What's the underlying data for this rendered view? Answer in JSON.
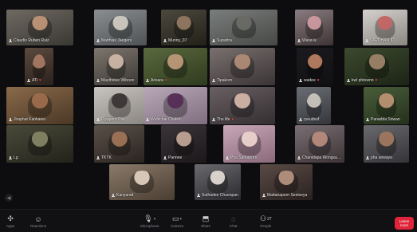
{
  "meeting": {
    "participants": [
      {
        "name": "Claudio Ruben Ruiz",
        "icon": "mic-icon",
        "colors": [
          "#6f6a62",
          "#3a3833"
        ],
        "fig": "#c89a7a"
      },
      {
        "name": "Matthias Jaegers",
        "icon": "mic-icon",
        "colors": [
          "#8b8f92",
          "#4f5254"
        ],
        "fig": "#d8d2c8"
      },
      {
        "name": "Munny_07",
        "icon": "mic-icon",
        "colors": [
          "#4c4a3e",
          "#222018"
        ],
        "fig": "#9a7e66"
      },
      {
        "name": "Supattra",
        "icon": "mic-icon",
        "colors": [
          "#7a7e7c",
          "#464845"
        ],
        "fig": "#6a6a64"
      },
      {
        "name": "Wasa w",
        "icon": "mic-icon",
        "colors": [
          "#8a7c80",
          "#3e3434"
        ],
        "fig": "#d6a0a6"
      },
      {
        "name": "VARDHAN ID",
        "icon": "mic-icon",
        "colors": [
          "#d4d0cc",
          "#8a8680"
        ],
        "fig": "#c45a5a"
      },
      {
        "name": "ATi",
        "icon": "mic-icon",
        "heart": true,
        "colors": [
          "#5c4a3e",
          "#2a211c"
        ],
        "fig": "#b08068"
      },
      {
        "name": "Maythinee Wiboon",
        "icon": "mic-icon",
        "colors": [
          "#7e766e",
          "#3c3834"
        ],
        "fig": "#d8c0b0"
      },
      {
        "name": "Arisara",
        "icon": "mic-icon",
        "heart": true,
        "colors": [
          "#5a6a3e",
          "#2e3a1e"
        ],
        "fig": "#c8a080"
      },
      {
        "name": "Tipakorn",
        "icon": "mic-icon",
        "colors": [
          "#7a7070",
          "#3a3434"
        ],
        "fig": "#b89078"
      },
      {
        "name": "wadee",
        "icon": "mic-icon",
        "heart": true,
        "colors": [
          "#1c1a1e",
          "#101012"
        ],
        "fig": "#c88a68"
      },
      {
        "name": "kwl phtownn",
        "icon": "mic-icon",
        "heart": true,
        "colors": [
          "#3c4a2e",
          "#1c2416"
        ],
        "fig": "#a88a70"
      },
      {
        "name": "Jiraphat Kankaew",
        "icon": "mic-icon",
        "colors": [
          "#8a6a4a",
          "#4a3826"
        ],
        "fig": "#a06e4e"
      },
      {
        "name": "Piyaporn Pia",
        "icon": "mic-icon",
        "colors": [
          "#c8c4c0",
          "#8a8682"
        ],
        "fig": "#2a2424"
      },
      {
        "name": "Wuttichai Chaisri",
        "icon": "mic-icon",
        "colors": [
          "#b8a8b8",
          "#7e6e7e"
        ],
        "fig": "#4a1e4a"
      },
      {
        "name": "The life",
        "icon": "mic-icon",
        "heart": true,
        "colors": [
          "#6a6064",
          "#332e30"
        ],
        "fig": "#e0c0b0"
      },
      {
        "name": "ryeudsuf",
        "icon": "mic-icon",
        "colors": [
          "#6a6e74",
          "#34363a"
        ],
        "fig": "#d8d0c8"
      },
      {
        "name": "Panadda Sriwan",
        "icon": "mic-icon",
        "colors": [
          "#4a5e3a",
          "#24301c"
        ],
        "fig": "#c89a7a"
      },
      {
        "name": "Lg",
        "icon": "mic-icon",
        "colors": [
          "#4a4a3a",
          "#22221a"
        ],
        "fig": "#8a8a6a"
      },
      {
        "name": "TKTK",
        "icon": "mic-icon",
        "colors": [
          "#5a5048",
          "#2a2420"
        ],
        "fig": "#a8785a"
      },
      {
        "name": "Pannee",
        "icon": "mic-icon",
        "colors": [
          "#3a3438",
          "#1c181a"
        ],
        "fig": "#d0b0a0"
      },
      {
        "name": "Pha Sathaporn",
        "icon": "mic-icon",
        "colors": [
          "#c8a8b8",
          "#8a6a7a"
        ],
        "fig": "#f0d8d0"
      },
      {
        "name": "Chanidapa Wongsawat",
        "icon": "mic-icon",
        "colors": [
          "#7a6e72",
          "#3c3436"
        ],
        "fig": "#c09080"
      },
      {
        "name": "pha anwaya",
        "icon": "mic-icon",
        "colors": [
          "#6a6a6e",
          "#343438"
        ],
        "fig": "#a87a5e"
      },
      {
        "name": "Kanyaratt",
        "icon": "mic-icon",
        "colors": [
          "#8a7a6a",
          "#4a3e32"
        ],
        "fig": "#e8d8c8"
      },
      {
        "name": "Suthadee Chuenpan",
        "icon": "mic-icon",
        "colors": [
          "#6a6a6e",
          "#2a2a2e"
        ],
        "fig": "#f0e8e0"
      },
      {
        "name": "Mattanaporn Seeleeya",
        "icon": "mic-icon",
        "colors": [
          "#5a4a46",
          "#2a2220"
        ],
        "fig": "#c09a86"
      }
    ]
  },
  "toolbar": {
    "left": [
      {
        "id": "apps",
        "icon": "apps-icon",
        "glyph": "✣",
        "label": "Apps"
      },
      {
        "id": "reactions",
        "icon": "smiley-icon",
        "glyph": "☺",
        "label": "Reactions"
      }
    ],
    "center": [
      {
        "id": "mic",
        "icon": "microphone-icon",
        "glyph": "🎙",
        "label": "Microphone",
        "caret": true
      },
      {
        "id": "camera",
        "icon": "camera-icon",
        "glyph": "▭",
        "label": "Camera",
        "caret": true
      },
      {
        "id": "share",
        "icon": "share-icon",
        "glyph": "⬒",
        "label": "Share"
      },
      {
        "id": "chat",
        "icon": "chat-icon",
        "glyph": "◌",
        "label": "Chat"
      },
      {
        "id": "people",
        "icon": "people-icon",
        "glyph": "⚇",
        "label": "People",
        "count": "27"
      }
    ],
    "end_label_1": "Leave",
    "end_label_2": "room"
  }
}
